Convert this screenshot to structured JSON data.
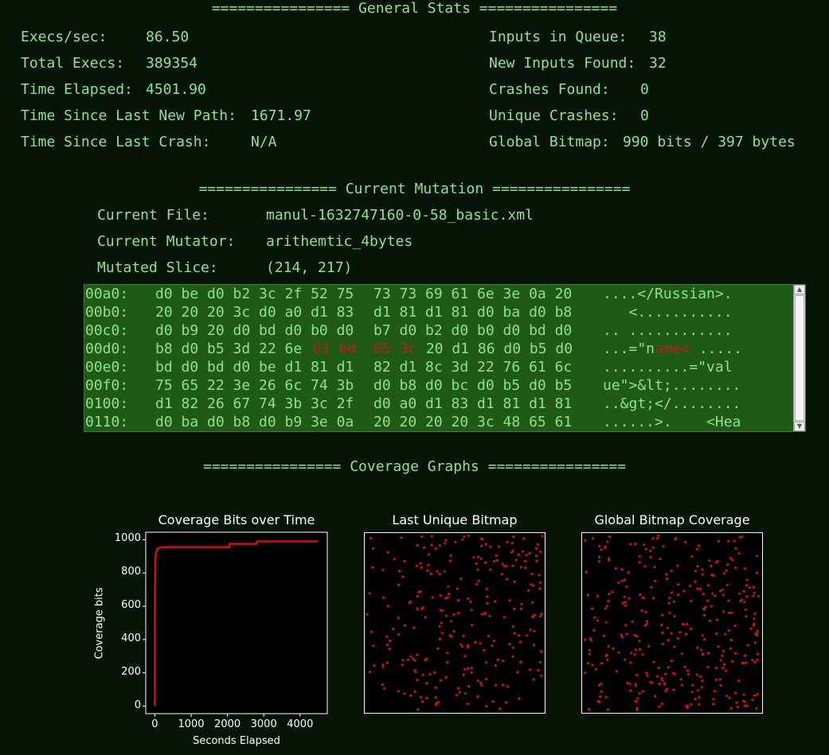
{
  "sections": {
    "general": "================ General Stats ================",
    "mutation": "================ Current Mutation ================",
    "graphs": "================ Coverage Graphs ================"
  },
  "stats_left": [
    {
      "label": "Execs/sec:",
      "value": "86.50"
    },
    {
      "label": "Total Execs:",
      "value": "389354"
    },
    {
      "label": "Time Elapsed:",
      "value": "4501.90"
    },
    {
      "label": "Time Since Last New Path:",
      "value": "1671.97"
    },
    {
      "label": "Time Since Last Crash:",
      "value": "N/A"
    }
  ],
  "stats_right": [
    {
      "label": "Inputs in Queue:",
      "value": "38"
    },
    {
      "label": "New Inputs Found:",
      "value": "32"
    },
    {
      "label": "Crashes Found:",
      "value": "0"
    },
    {
      "label": "Unique Crashes:",
      "value": "0"
    },
    {
      "label": "Global Bitmap:",
      "value": "990 bits / 397 bytes"
    }
  ],
  "mutation": [
    {
      "label": "Current File:",
      "value": "manul-1632747160-0-58_basic.xml"
    },
    {
      "label": "Current Mutator:",
      "value": "arithemtic_4bytes"
    },
    {
      "label": "Mutated Slice:",
      "value": "(214, 217)"
    }
  ],
  "hexdump": [
    {
      "offset": "00a0:",
      "g1": "d0 be d0 b2 3c 2f 52 75",
      "g2": "73 73 69 61 6e 3e 0a 20",
      "ascii": "....</Russian>."
    },
    {
      "offset": "00b0:",
      "g1": "20 20 20 3c d0 a0 d1 83",
      "g2": "d1 81 d1 81 d0 ba d0 b8",
      "ascii": "   <..........."
    },
    {
      "offset": "00c0:",
      "g1": "d0 b9 20 d0 bd d0 b0 d0",
      "g2": "b7 d0 b2 d0 b0 d0 bd d0",
      "ascii": ".. ............"
    },
    {
      "offset": "00d0:",
      "g1_pre": "b8 d0 b5 3d 22 6e ",
      "g1_hot": "61 6d",
      "g2_hot": "65 3c",
      "g2_post": " 20 d1 86 d0 b5 d0",
      "ascii_pre": "...=\"n",
      "ascii_hot": "ame<",
      "ascii_post": " ....."
    },
    {
      "offset": "00e0:",
      "g1": "bd d0 bd d0 be d1 81 d1",
      "g2": "82 d1 8c 3d 22 76 61 6c",
      "ascii": "..........=\"val"
    },
    {
      "offset": "00f0:",
      "g1": "75 65 22 3e 26 6c 74 3b",
      "g2": "d0 b8 d0 bc d0 b5 d0 b5",
      "ascii": "ue\">&lt;........"
    },
    {
      "offset": "0100:",
      "g1": "d1 82 26 67 74 3b 3c 2f",
      "g2": "d0 a0 d1 83 d1 81 d1 81",
      "ascii": "..&gt;</........"
    },
    {
      "offset": "0110:",
      "g1": "d0 ba d0 b8 d0 b9 3e 0a",
      "g2": "20 20 20 20 3c 48 65 61",
      "ascii": "......>.    <Hea"
    }
  ],
  "colors": {
    "background": "#061406",
    "text": "#8fe38f",
    "hex_panel": "#1f5a17",
    "highlight": "#c21a1a",
    "plot_line": "#d01010"
  },
  "chart_data": [
    {
      "type": "line",
      "title": "Coverage Bits over Time",
      "xlabel": "Seconds Elapsed",
      "ylabel": "Coverage bits",
      "xlim": [
        -250,
        4750
      ],
      "ylim": [
        -45,
        1045
      ],
      "xticks": [
        0,
        1000,
        2000,
        3000,
        4000
      ],
      "yticks": [
        0,
        200,
        400,
        600,
        800,
        1000
      ],
      "series": [
        {
          "x": [
            0,
            5,
            15,
            30,
            60,
            100,
            200,
            500,
            1000,
            1500,
            2050,
            2060,
            2500,
            2800,
            2810,
            3500,
            4000,
            4500
          ],
          "y": [
            0,
            700,
            880,
            920,
            940,
            950,
            955,
            955,
            955,
            955,
            955,
            975,
            975,
            975,
            990,
            990,
            990,
            990
          ]
        }
      ]
    },
    {
      "type": "scatter",
      "title": "Last Unique Bitmap"
    },
    {
      "type": "scatter",
      "title": "Global Bitmap Coverage"
    }
  ]
}
